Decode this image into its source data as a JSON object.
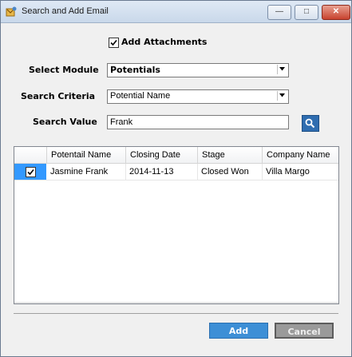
{
  "window": {
    "title": "Search and Add Email",
    "controls": {
      "minimize": "—",
      "maximize": "□",
      "close": "✕"
    }
  },
  "form": {
    "add_attachments": {
      "label": "Add Attachments",
      "checked": true
    },
    "select_module": {
      "label": "Select Module",
      "value": "Potentials"
    },
    "search_criteria": {
      "label": "Search Criteria",
      "value": "Potential Name"
    },
    "search_value": {
      "label": "Search Value",
      "value": "Frank"
    }
  },
  "grid": {
    "columns": [
      "",
      "Potentail Name",
      "Closing Date",
      "Stage",
      "Company Name"
    ],
    "rows": [
      {
        "selected": true,
        "potential_name": "Jasmine Frank",
        "closing_date": "2014-11-13",
        "stage": "Closed Won",
        "company_name": "Villa Margo"
      }
    ]
  },
  "buttons": {
    "add": "Add",
    "cancel": "Cancel"
  },
  "colors": {
    "accent": "#3399ff",
    "add_button": "#3d8fd6",
    "cancel_button": "#9a9a9a",
    "search_button": "#2f6db0"
  },
  "icons": [
    "app-icon",
    "checkbox-checked-icon",
    "dropdown-arrow-icon",
    "search-icon"
  ]
}
